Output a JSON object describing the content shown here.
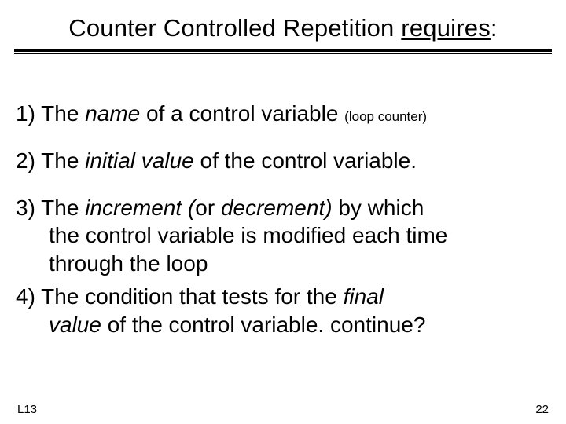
{
  "title": {
    "pre": "Counter Controlled Repetition ",
    "underlined": "requires",
    "colon": ":"
  },
  "points": {
    "p1_lead": "1) The ",
    "p1_italic": "name",
    "p1_rest": " of a control variable ",
    "p1_sub": "(loop counter)",
    "p2_lead": "2) The ",
    "p2_italic": "initial value",
    "p2_rest": "  of the control variable.",
    "p3_lead": "3) The ",
    "p3_italic1": "increment (",
    "p3_mid": "or ",
    "p3_italic2": "decrement)",
    "p3_rest1": " by which",
    "p3_line2": "the control variable is modified each time",
    "p3_line3": "through the loop",
    "p4_lead": "4) The condition that tests for the ",
    "p4_italic1": "final",
    "p4_italic2": "value",
    "p4_rest": " of the control variable. continue?"
  },
  "footer": {
    "left": "L13",
    "right": "22"
  }
}
